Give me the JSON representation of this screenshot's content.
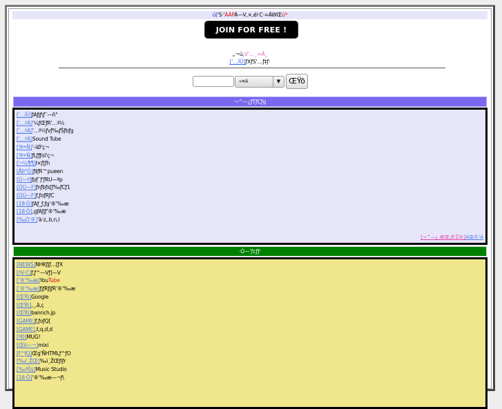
{
  "topbar": {
    "segments": [
      {
        "text": "ú(",
        "color": "blue"
      },
      {
        "text": "'S·'",
        "color": "black"
      },
      {
        "text": "ÀÁP",
        "color": "red"
      },
      {
        "text": "Á—V,×,él·C·=ÁWŒ",
        "color": "black"
      },
      {
        "text": "ú*",
        "color": "red"
      }
    ]
  },
  "join_button": {
    "label": "JOIN FOR FREE !"
  },
  "info": {
    "line1_prefix": "„¬ú,",
    "line1_pink": "V'…¸=Á_",
    "line2_link": "['…ÌÛ]",
    "line2_text": "ƒXƒS'…ƒ‡ƒ·"
  },
  "search": {
    "input_value": "",
    "select_value": "»¤Á",
    "button_label": "ŒŸõ"
  },
  "section1": {
    "title": "¬^—¿ƒTƒCƒg",
    "items": [
      {
        "tag": "['…ÌÛ]",
        "label": "ƒAƒjƒ\\ƒ˜—ñ\""
      },
      {
        "tag": "['…ºÀ]",
        "label": "'¼ƒŒƒR'…ª½"
      },
      {
        "tag": "['…ºÀ]",
        "label": "'…ª½ƒvƒ‰ƒŠƒbƒg"
      },
      {
        "tag": "['…ºÀ]",
        "label": "Sound Tube"
      },
      {
        "tag": "[³Þ•Ñ]",
        "label": "'–ìØ'ç¬"
      },
      {
        "tag": "[³Þ•Ñ]",
        "label": "ƒLƒƒƒoï'ç¬"
      },
      {
        "tag": "[¬¼¶¶]",
        "label": "ł×ƒ[ƒh"
      },
      {
        "tag": "[ÅÞ°Ö]",
        "label": "ƒ‡ƒR™pueen"
      },
      {
        "tag": "[Ù—ª]",
        "label": "ƒpƒ`ƒ'ƒRU—ªp"
      },
      {
        "tag": "[ÓÛ—F]",
        "label": "ƒnƒbƒs[ƒ‰ƒCƒ1"
      },
      {
        "tag": "[ÓÛ—F]",
        "label": "ƒ‚ƒoƒRƒC"
      },
      {
        "tag": "[18·Ö]",
        "label": "ƒAƒ_ƒ‚ƒg'®'‰æ"
      },
      {
        "tag": "[18·Ö]",
        "label": "‚gƒAƒjƒ'®'‰æ"
      },
      {
        "tag": "[‰Ó'®]",
        "label": "'à·z‚.b‚n‚l"
      }
    ],
    "more": {
      "pink": "[¬^—¿ ÆŒ‚ß'Ž®]",
      "blue": "ÀŒ©'Á"
    }
  },
  "section2": {
    "title": "·Ó—'ƒcƒƒ·",
    "items": [
      {
        "tag": "[NEWS]",
        "label": "NHKƒjƒ…[ƒX"
      },
      {
        "tag": "[ºV·C]",
        "label": "ƒ‚ƒ^—Vƒ]—V"
      },
      {
        "tag": "['®'‰æ]",
        "label": "You",
        "label_red": "Tube"
      },
      {
        "tag": "['®'‰æ]",
        "label": "ƒjƒRƒjƒR'®'‰æ"
      },
      {
        "tag": "[ŒŸõ]",
        "label": "Google"
      },
      {
        "tag": "[ŒŸõ]",
        "label": "‚¸‚ã‚ç"
      },
      {
        "tag": "[ŒŸõ]",
        "label": "bannch.jp"
      },
      {
        "tag": "[GAME]",
        "label": "ƒ‚ƒoƒQ["
      },
      {
        "tag": "[GAME]",
        "label": "‚t‚q‚d‚d"
      },
      {
        "tag": "[ºÐ­]",
        "label": "MUG!"
      },
      {
        "tag": "[Œõ—¬]",
        "label": "mixi"
      },
      {
        "tag": "[ƒ^ƒO]",
        "label": "Œg'ÑHTMLƒ^ƒO"
      },
      {
        "tag": "[‰ï¸ŽŒ]",
        "label": "‰ï¸ŽŒƒiƒr"
      },
      {
        "tag": "[‰ªŠÿ]",
        "label": "Music Studio"
      },
      {
        "tag": "[18·Ö]",
        "label": "'®'‰æ—¬ƒ\\"
      }
    ]
  }
}
